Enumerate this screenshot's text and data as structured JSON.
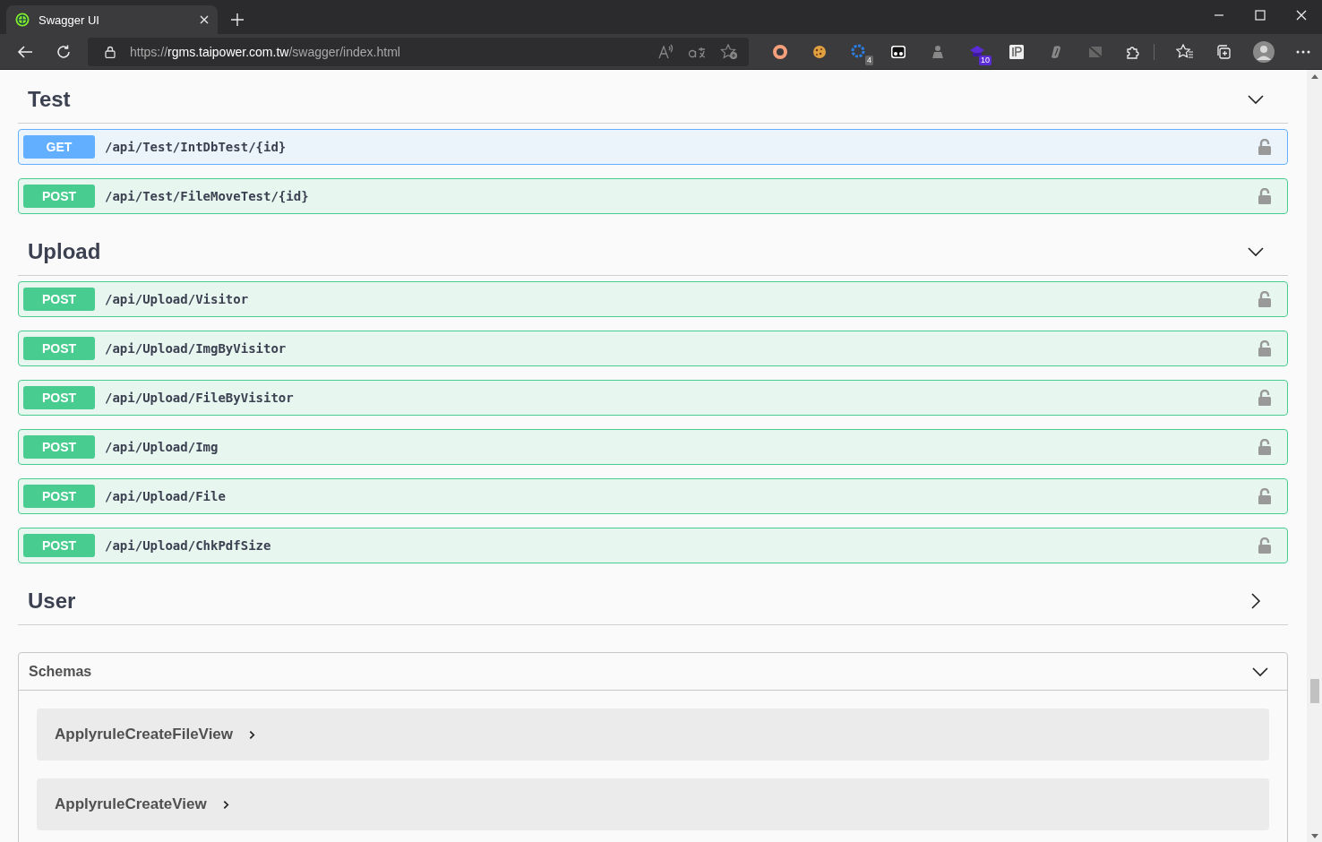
{
  "browser": {
    "tabs": [
      {
        "title": "Swagger UI",
        "selected": true
      }
    ],
    "url": {
      "scheme": "https://",
      "host": "rgms.taipower.com.tw",
      "path": "/swagger/index.html"
    },
    "extensions": [
      {
        "kind": "ring"
      },
      {
        "kind": "cookie"
      },
      {
        "kind": "gear",
        "badge": "4"
      },
      {
        "kind": "eyes"
      },
      {
        "kind": "figure"
      },
      {
        "kind": "cap",
        "badge": "10"
      },
      {
        "kind": "ip"
      },
      {
        "kind": "leaf"
      },
      {
        "kind": "slash"
      }
    ]
  },
  "sections": [
    {
      "name": "Test",
      "expanded": true,
      "operations": [
        {
          "kind": "get",
          "method": "GET",
          "path": "/api/Test/IntDbTest/{id}"
        },
        {
          "kind": "post",
          "method": "POST",
          "path": "/api/Test/FileMoveTest/{id}"
        }
      ]
    },
    {
      "name": "Upload",
      "expanded": true,
      "operations": [
        {
          "kind": "post",
          "method": "POST",
          "path": "/api/Upload/Visitor"
        },
        {
          "kind": "post",
          "method": "POST",
          "path": "/api/Upload/ImgByVisitor"
        },
        {
          "kind": "post",
          "method": "POST",
          "path": "/api/Upload/FileByVisitor"
        },
        {
          "kind": "post",
          "method": "POST",
          "path": "/api/Upload/Img"
        },
        {
          "kind": "post",
          "method": "POST",
          "path": "/api/Upload/File"
        },
        {
          "kind": "post",
          "method": "POST",
          "path": "/api/Upload/ChkPdfSize"
        }
      ]
    },
    {
      "name": "User",
      "expanded": false
    }
  ],
  "schemas": {
    "title": "Schemas",
    "expanded": true,
    "models": [
      "ApplyruleCreateFileView",
      "ApplyruleCreateView"
    ]
  }
}
